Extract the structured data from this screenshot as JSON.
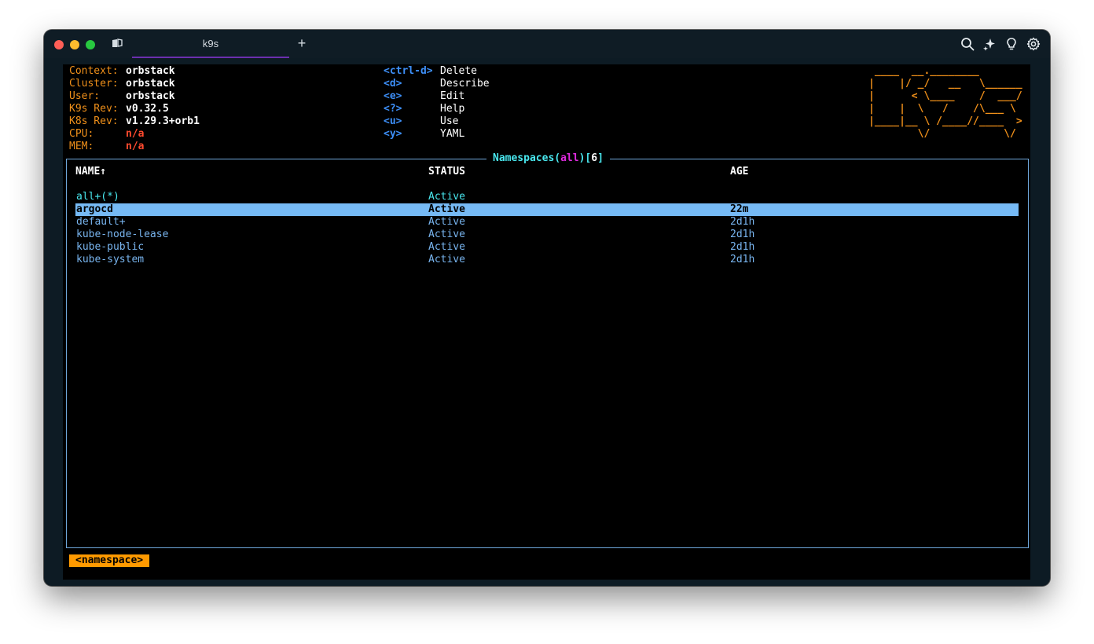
{
  "tab": {
    "title": "k9s"
  },
  "icons": [
    "panes-icon",
    "plus-icon",
    "search-icon",
    "sparkle-icon",
    "lightbulb-icon",
    "gear-icon"
  ],
  "info": [
    {
      "label": "Context:",
      "value": "orbstack",
      "style": "val"
    },
    {
      "label": "Cluster:",
      "value": "orbstack",
      "style": "val"
    },
    {
      "label": "User:",
      "value": "orbstack",
      "style": "val"
    },
    {
      "label": "K9s Rev:",
      "value": "v0.32.5",
      "style": "val"
    },
    {
      "label": "K8s Rev:",
      "value": "v1.29.3+orb1",
      "style": "val"
    },
    {
      "label": "CPU:",
      "value": "n/a",
      "style": "val-red"
    },
    {
      "label": "MEM:",
      "value": "n/a",
      "style": "val-red"
    }
  ],
  "shortcuts": [
    {
      "key": "<ctrl-d>",
      "action": "Delete"
    },
    {
      "key": "<d>",
      "action": "Describe"
    },
    {
      "key": "<e>",
      "action": "Edit"
    },
    {
      "key": "<?>",
      "action": "Help"
    },
    {
      "key": "<u>",
      "action": "Use"
    },
    {
      "key": "<y>",
      "action": "YAML"
    }
  ],
  "logo": [
    " ____  __.________       ",
    "|    |/ _/   __   \\______",
    "|      < \\____    /  ___/",
    "|    |  \\   /    /\\___ \\ ",
    "|____|__ \\ /____//____  >",
    "        \\/            \\/ "
  ],
  "table": {
    "title_a": "Namespaces(",
    "title_b": "all",
    "title_c": ")[",
    "title_d": "6",
    "title_e": "]",
    "columns": [
      "NAME↑",
      "STATUS",
      "AGE"
    ],
    "rows": [
      {
        "name": "all+(*)",
        "status": "Active",
        "age": "",
        "style": "teal"
      },
      {
        "name": "argocd",
        "status": "Active",
        "age": "22m",
        "style": "sel"
      },
      {
        "name": "default+",
        "status": "Active",
        "age": "2d1h",
        "style": "blue"
      },
      {
        "name": "kube-node-lease",
        "status": "Active",
        "age": "2d1h",
        "style": "blue"
      },
      {
        "name": "kube-public",
        "status": "Active",
        "age": "2d1h",
        "style": "blue"
      },
      {
        "name": "kube-system",
        "status": "Active",
        "age": "2d1h",
        "style": "blue"
      }
    ]
  },
  "breadcrumb": "<namespace>",
  "colors": {
    "label": "#f0901a",
    "key": "#3d8ff8",
    "frame": "#6fa8dc",
    "selected_row": "#76baf5",
    "breadcrumb": "#ff9a00",
    "accent_tab": "#6b2fae"
  }
}
